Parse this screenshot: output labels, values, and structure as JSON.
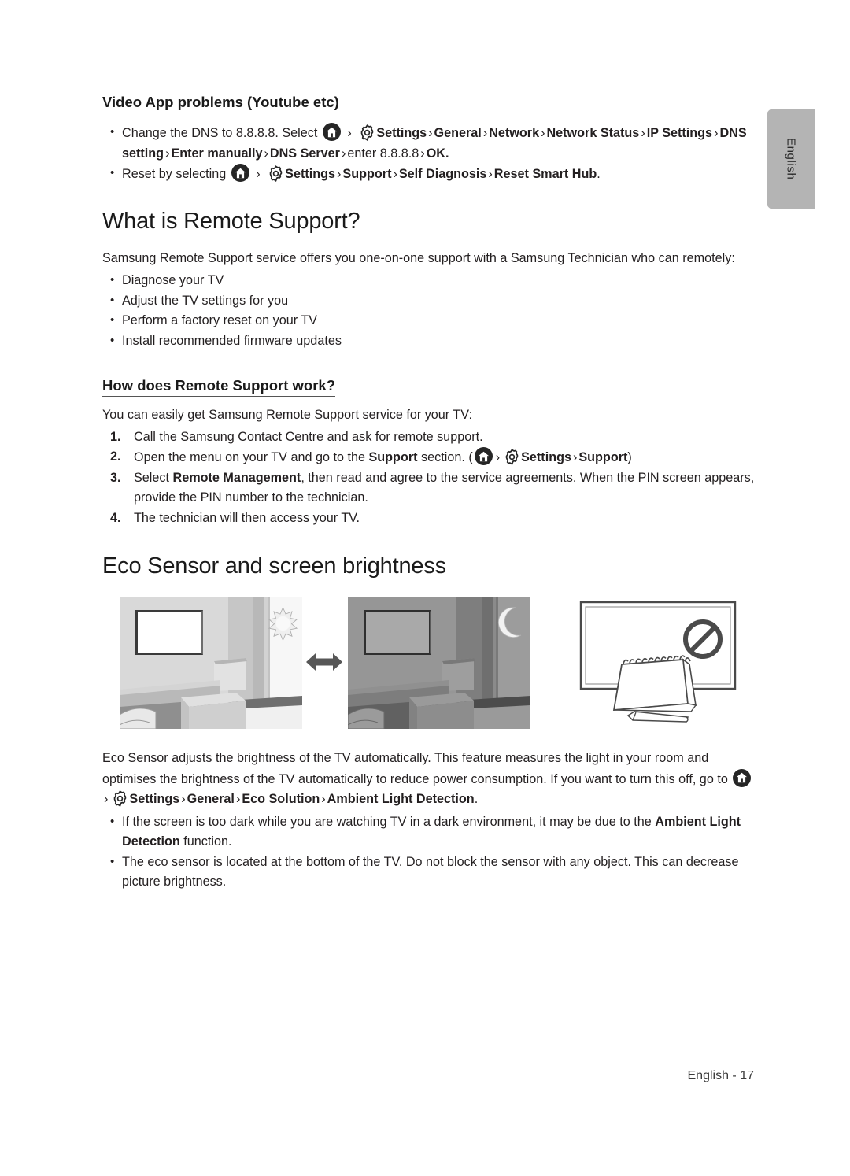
{
  "side_tab": {
    "label": "English"
  },
  "footer": {
    "page_label": "English - 17"
  },
  "icons": {
    "home": "home-icon",
    "gear": "gear-icon",
    "arrow": "double-arrow-icon",
    "prohibited": "prohibited-icon",
    "sun": "sun-icon",
    "moon": "moon-icon"
  },
  "sections": {
    "video_app": {
      "heading": "Video App problems (Youtube etc)",
      "bullet1": {
        "lead": "Change the DNS to 8.8.8.8. Select",
        "path": [
          "Settings",
          "General",
          "Network",
          "Network Status",
          "IP Settings",
          "DNS setting",
          "Enter manually",
          "DNS Server"
        ],
        "tail_lead": "enter 8.8.8.8",
        "tail_end": "OK."
      },
      "bullet2": {
        "lead": "Reset by selecting",
        "path": [
          "Settings",
          "Support",
          "Self Diagnosis",
          "Reset Smart Hub"
        ],
        "tail_end": "."
      }
    },
    "remote_support": {
      "title": "What is Remote Support?",
      "intro": "Samsung Remote Support service offers you one-on-one support with a Samsung Technician who can remotely:",
      "bullets": [
        "Diagnose your TV",
        "Adjust the TV settings for you",
        "Perform a factory reset on your TV",
        "Install recommended firmware updates"
      ]
    },
    "how_it_works": {
      "heading": "How does Remote Support work?",
      "intro": "You can easily get Samsung Remote Support service for your TV:",
      "steps": [
        {
          "num": "1.",
          "text": "Call the Samsung Contact Centre and ask for remote support."
        },
        {
          "num": "2.",
          "pre": "Open the menu on your TV and go to the ",
          "bold": "Support",
          "mid": " section. (",
          "path": [
            "Settings",
            "Support"
          ],
          "post": ")"
        },
        {
          "num": "3.",
          "pre": "Select ",
          "bold": "Remote Management",
          "post": ", then read and agree to the service agreements. When the PIN screen appears, provide the PIN number to the technician."
        },
        {
          "num": "4.",
          "text": "The technician will then access your TV."
        }
      ]
    },
    "eco_sensor": {
      "title": "Eco Sensor and screen brightness",
      "paragraph_pre": "Eco Sensor adjusts the brightness of the TV automatically. This feature measures the light in your room and optimises the brightness of the TV automatically to reduce power consumption. If you want to turn this off, go to",
      "path": [
        "Settings",
        "General",
        "Eco Solution",
        "Ambient Light Detection"
      ],
      "paragraph_post": ".",
      "bullets": [
        {
          "pre": "If the screen is too dark while you are watching TV in a dark environment, it may be due to the ",
          "bold": "Ambient Light Detection",
          "post": " function."
        },
        {
          "pre": "The eco sensor is located at the bottom of the TV. Do not block the sensor with any object. This can decrease picture brightness.",
          "bold": "",
          "post": ""
        }
      ]
    }
  }
}
